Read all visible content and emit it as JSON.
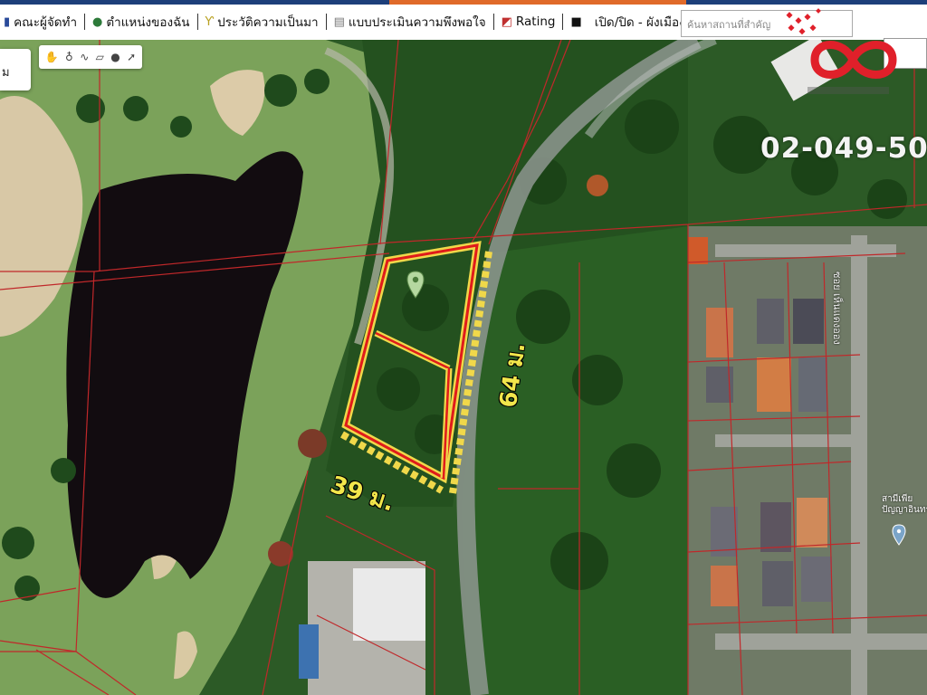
{
  "toolbar": {
    "items": [
      {
        "label": "คณะผู้จัดทำ",
        "icon": "book-icon"
      },
      {
        "label": "ตำแหน่งของฉัน",
        "icon": "globe-icon"
      },
      {
        "label": "ประวัติความเป็นมา",
        "icon": "sprout-icon"
      },
      {
        "label": "แบบประเมินความพึงพอใจ",
        "icon": "document-icon"
      },
      {
        "label": "Rating",
        "icon": "chart-icon"
      },
      {
        "label": "เปิด/ปิด - ผังเมือง",
        "icon": "checkbox-icon"
      }
    ],
    "search_placeholder": "ค้นหาสถานที่สำคัญ"
  },
  "layer_select": {
    "value": "ม"
  },
  "draw_tools": [
    "hand-icon",
    "pin-icon",
    "polyline-icon",
    "polygon-icon",
    "circle-icon",
    "ruler-icon"
  ],
  "watermark": {
    "phone": "02-049-50"
  },
  "parcel": {
    "side_label": "64 ม.",
    "front_label": "39 ม."
  },
  "map_labels": {
    "road": "ซอย เห็นแดงออง",
    "poi_line1": "สามีเพีย",
    "poi_line2": "ปัญญาอินทรา"
  },
  "colors": {
    "parcel_outline": "#f0d84a",
    "parcel_inner": "#e01b1b",
    "boundary_lines": "#c0282a",
    "logo_red": "#e0202a",
    "accent_navy": "#1d3f7a",
    "accent_orange": "#e06a2a"
  }
}
